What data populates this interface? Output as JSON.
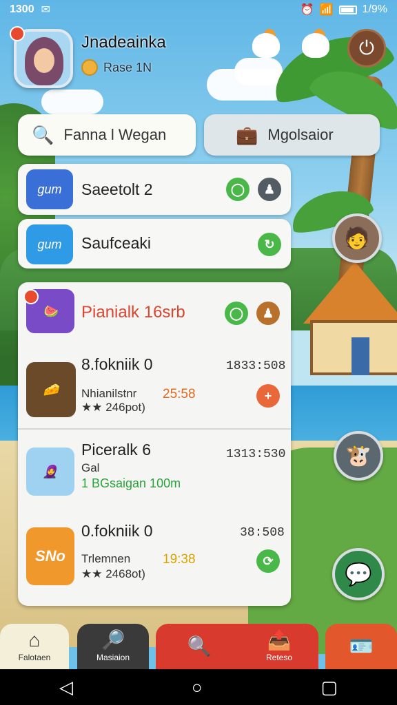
{
  "status_bar": {
    "time": "1300",
    "battery": "1/9%"
  },
  "profile": {
    "name": "Jnadeainka",
    "rank": "Rase 1N"
  },
  "search_buttons": {
    "search_label": "Fanna l Wegan",
    "moderator_label": "Mgolsaior"
  },
  "list_rows": [
    {
      "icon_text": "gum",
      "title": "Saeetolt 2",
      "icon_color": "#3a6fd8"
    },
    {
      "icon_text": "gum",
      "title": "Saufceaki",
      "icon_color": "#2f9be6"
    }
  ],
  "featured": {
    "title": "Pianialk 16srb",
    "title_color": "#d9452e"
  },
  "entries": [
    {
      "title": "8.fokniik 0",
      "time": "1833:508",
      "subtitle": "Nhianilstnr",
      "score": "25:58",
      "rating": "246pot)",
      "score_color": "#e06a1e"
    },
    {
      "title": "Piceralk 6",
      "time": "1313:530",
      "subtitle": "Gal",
      "highlight": "1 BGsaigan 100m",
      "highlight_color": "#2aa33a"
    },
    {
      "title": "0.fokniik 0",
      "time": "38:508",
      "subtitle": "Trlemnen",
      "score": "19:38",
      "rating": "2468ot)",
      "icon_text": "SNo",
      "score_color": "#d8a400"
    }
  ],
  "tabs": [
    {
      "label": "Falotaen",
      "icon": "home-icon",
      "color": "#f3efd9",
      "text_color": "#333"
    },
    {
      "label": "Masiaion",
      "icon": "search-icon",
      "color": "#3a3a3a",
      "text_color": "#fff"
    },
    {
      "label": "",
      "icon": "magnifier-icon",
      "color": "#d83a2e",
      "text_color": "#fff"
    },
    {
      "label": "Reteso",
      "icon": "share-icon",
      "color": "#d83a2e",
      "text_color": "#fff"
    },
    {
      "label": "",
      "icon": "profile-card-icon",
      "color": "#e2572b",
      "text_color": "#fff"
    }
  ]
}
